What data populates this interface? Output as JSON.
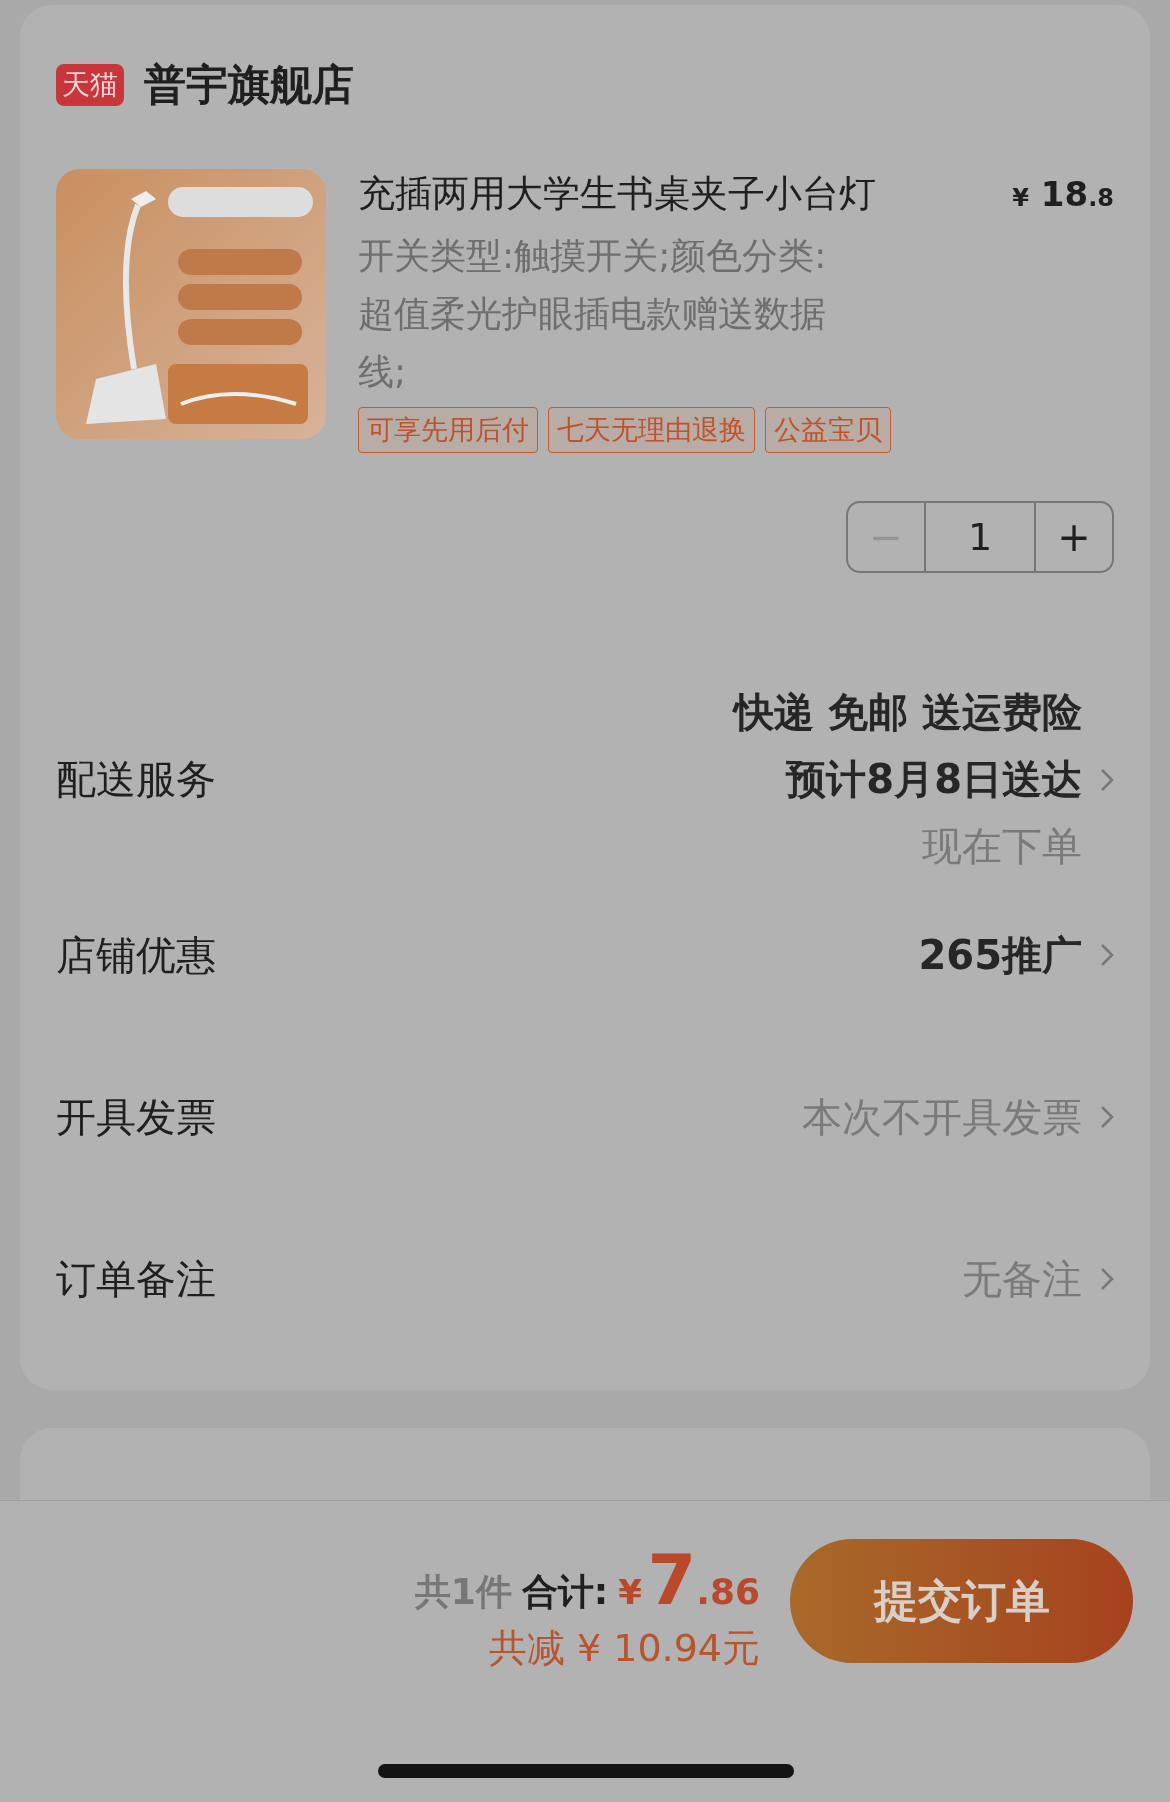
{
  "store": {
    "badge": "天猫",
    "name": "普宇旗舰店"
  },
  "product": {
    "title": "充插两用大学生书桌夹子小台灯",
    "price": {
      "symbol": "¥",
      "integer": "18",
      "decimal": ".8"
    },
    "spec": "开关类型:触摸开关;颜色分类:超值柔光护眼插电款赠送数据线;",
    "tags": [
      "可享先用后付",
      "七天无理由退换",
      "公益宝贝"
    ],
    "quantity": "1",
    "minus_disabled": true,
    "minus": "−",
    "plus": "+"
  },
  "rows": [
    {
      "label": "配送服务",
      "lines": [
        {
          "text": "快递 免邮 送运费险",
          "kind": "strong"
        },
        {
          "text": "预计8月8日送达",
          "kind": "strong"
        },
        {
          "text": "现在下单",
          "kind": "muted"
        }
      ]
    },
    {
      "label": "店铺优惠",
      "lines": [
        {
          "text": "265推广",
          "kind": "strong"
        }
      ]
    },
    {
      "label": "开具发票",
      "lines": [
        {
          "text": "本次不开具发票",
          "kind": "muted"
        }
      ]
    },
    {
      "label": "订单备注",
      "lines": [
        {
          "text": "无备注",
          "kind": "muted"
        }
      ]
    }
  ],
  "footer": {
    "count": "共1件",
    "total_label": "合计:",
    "currency": "¥",
    "total_integer": "7",
    "total_decimal": ".86",
    "savings": "共减 ¥ 10.94元",
    "submit": "提交订单"
  }
}
